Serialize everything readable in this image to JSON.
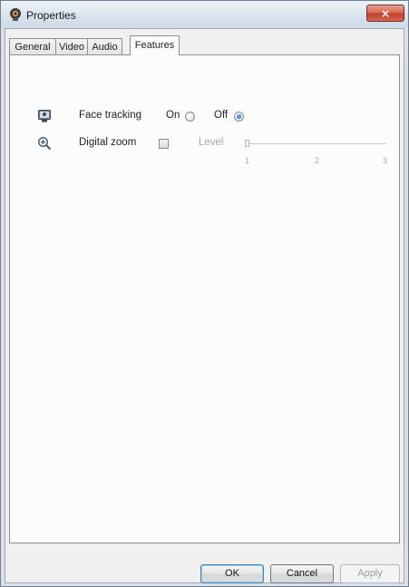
{
  "window": {
    "title": "Properties",
    "close_label": "×"
  },
  "tabs": [
    {
      "label": "General",
      "active": false
    },
    {
      "label": "Video",
      "active": false
    },
    {
      "label": "Audio",
      "active": false
    },
    {
      "label": "Features",
      "active": true
    }
  ],
  "features": {
    "face_tracking": {
      "label": "Face tracking",
      "icon": "webcam-icon",
      "on_label": "On",
      "off_label": "Off",
      "selected": "Off"
    },
    "digital_zoom": {
      "label": "Digital zoom",
      "icon": "zoom-in-icon",
      "checked": false,
      "level_label": "Level",
      "level_ticks": [
        "1",
        "2",
        "3"
      ],
      "level_value": 1,
      "enabled": false
    }
  },
  "buttons": {
    "ok": "OK",
    "cancel": "Cancel",
    "apply": "Apply"
  }
}
